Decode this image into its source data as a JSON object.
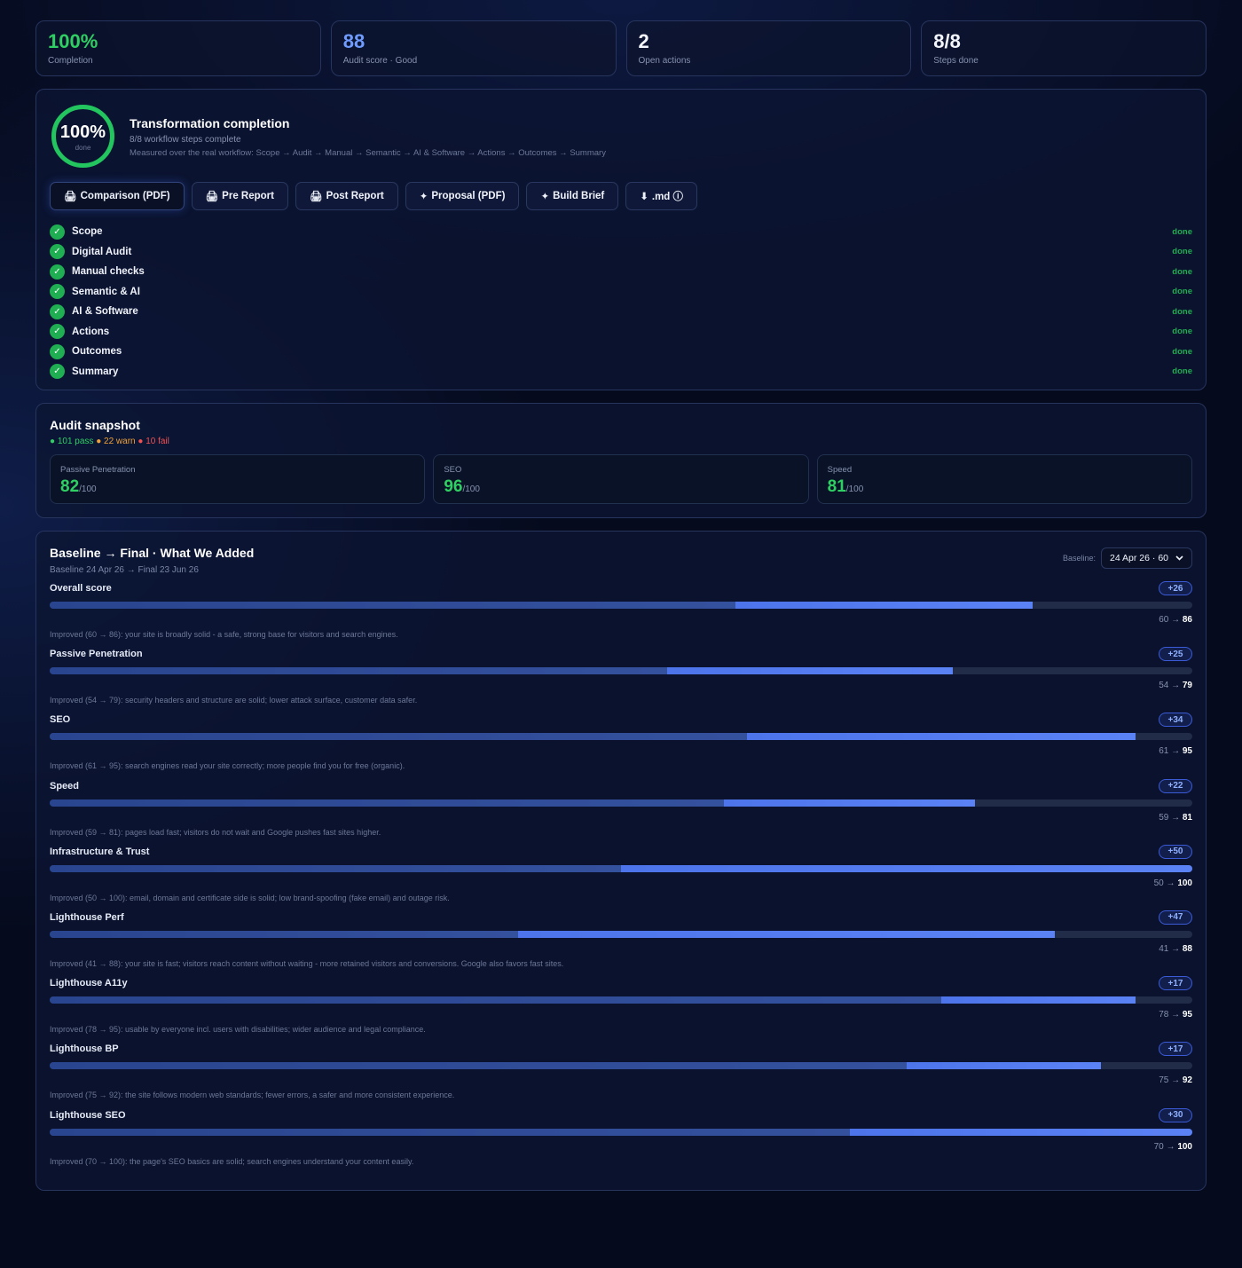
{
  "stats": [
    {
      "value": "100%",
      "label": "Completion",
      "color": "#2fcf63"
    },
    {
      "value": "88",
      "label": "Audit score · Good",
      "color": "#6f9bff"
    },
    {
      "value": "2",
      "label": "Open actions",
      "color": "#f2f5fc"
    },
    {
      "value": "8/8",
      "label": "Steps done",
      "color": "#f2f5fc"
    }
  ],
  "transformation": {
    "ring_value": "100%",
    "ring_label": "done",
    "ring_fraction": 1.0,
    "title": "Transformation completion",
    "subtitle": "8/8 workflow steps complete",
    "workflow": "Measured over the real workflow: Scope → Audit → Manual → Semantic → AI & Software → Actions → Outcomes → Summary",
    "buttons": [
      {
        "icon": "🖨",
        "label": "Comparison (PDF)"
      },
      {
        "icon": "🖨",
        "label": "Pre Report"
      },
      {
        "icon": "🖨",
        "label": "Post Report"
      },
      {
        "icon": "✦",
        "label": "Proposal (PDF)"
      },
      {
        "icon": "✦",
        "label": "Build Brief"
      },
      {
        "icon": "⬇",
        "label": ".md ⓘ"
      }
    ],
    "steps": [
      {
        "name": "Scope",
        "status": "done"
      },
      {
        "name": "Digital Audit",
        "status": "done"
      },
      {
        "name": "Manual checks",
        "status": "done"
      },
      {
        "name": "Semantic & AI",
        "status": "done"
      },
      {
        "name": "AI & Software",
        "status": "done"
      },
      {
        "name": "Actions",
        "status": "done"
      },
      {
        "name": "Outcomes",
        "status": "done"
      },
      {
        "name": "Summary",
        "status": "done"
      }
    ]
  },
  "audit": {
    "title": "Audit snapshot",
    "pass": "● 101 pass",
    "warn": "● 22 warn",
    "fail": "● 10 fail",
    "scores": [
      {
        "label": "Passive Penetration",
        "value": "82",
        "max": "/100"
      },
      {
        "label": "SEO",
        "value": "96",
        "max": "/100"
      },
      {
        "label": "Speed",
        "value": "81",
        "max": "/100"
      }
    ]
  },
  "baseline": {
    "title": "Baseline → Final · What We Added",
    "subtitle": "Baseline 24 Apr 26 → Final 23 Jun 26",
    "select_label": "Baseline:",
    "select_value": "24 Apr 26 · 60",
    "metrics": [
      {
        "name": "Overall score",
        "delta": "+26",
        "from": 60,
        "to": 86,
        "range_from": "60 → ",
        "range_to": "86",
        "desc": "Improved (60 → 86): your site is broadly solid - a safe, strong base for visitors and search engines."
      },
      {
        "name": "Passive Penetration",
        "delta": "+25",
        "from": 54,
        "to": 79,
        "range_from": "54 → ",
        "range_to": "79",
        "desc": "Improved (54 → 79): security headers and structure are solid; lower attack surface, customer data safer."
      },
      {
        "name": "SEO",
        "delta": "+34",
        "from": 61,
        "to": 95,
        "range_from": "61 → ",
        "range_to": "95",
        "desc": "Improved (61 → 95): search engines read your site correctly; more people find you for free (organic)."
      },
      {
        "name": "Speed",
        "delta": "+22",
        "from": 59,
        "to": 81,
        "range_from": "59 → ",
        "range_to": "81",
        "desc": "Improved (59 → 81): pages load fast; visitors do not wait and Google pushes fast sites higher."
      },
      {
        "name": "Infrastructure & Trust",
        "delta": "+50",
        "from": 50,
        "to": 100,
        "range_from": "50 → ",
        "range_to": "100",
        "desc": "Improved (50 → 100): email, domain and certificate side is solid; low brand-spoofing (fake email) and outage risk."
      },
      {
        "name": "Lighthouse Perf",
        "delta": "+47",
        "from": 41,
        "to": 88,
        "range_from": "41 → ",
        "range_to": "88",
        "desc": "Improved (41 → 88): your site is fast; visitors reach content without waiting - more retained visitors and conversions. Google also favors fast sites."
      },
      {
        "name": "Lighthouse A11y",
        "delta": "+17",
        "from": 78,
        "to": 95,
        "range_from": "78 → ",
        "range_to": "95",
        "desc": "Improved (78 → 95): usable by everyone incl. users with disabilities; wider audience and legal compliance."
      },
      {
        "name": "Lighthouse BP",
        "delta": "+17",
        "from": 75,
        "to": 92,
        "range_from": "75 → ",
        "range_to": "92",
        "desc": "Improved (75 → 92): the site follows modern web standards; fewer errors, a safer and more consistent experience."
      },
      {
        "name": "Lighthouse SEO",
        "delta": "+30",
        "from": 70,
        "to": 100,
        "range_from": "70 → ",
        "range_to": "100",
        "desc": "Improved (70 → 100): the page's SEO basics are solid; search engines understand your content easily."
      }
    ]
  }
}
